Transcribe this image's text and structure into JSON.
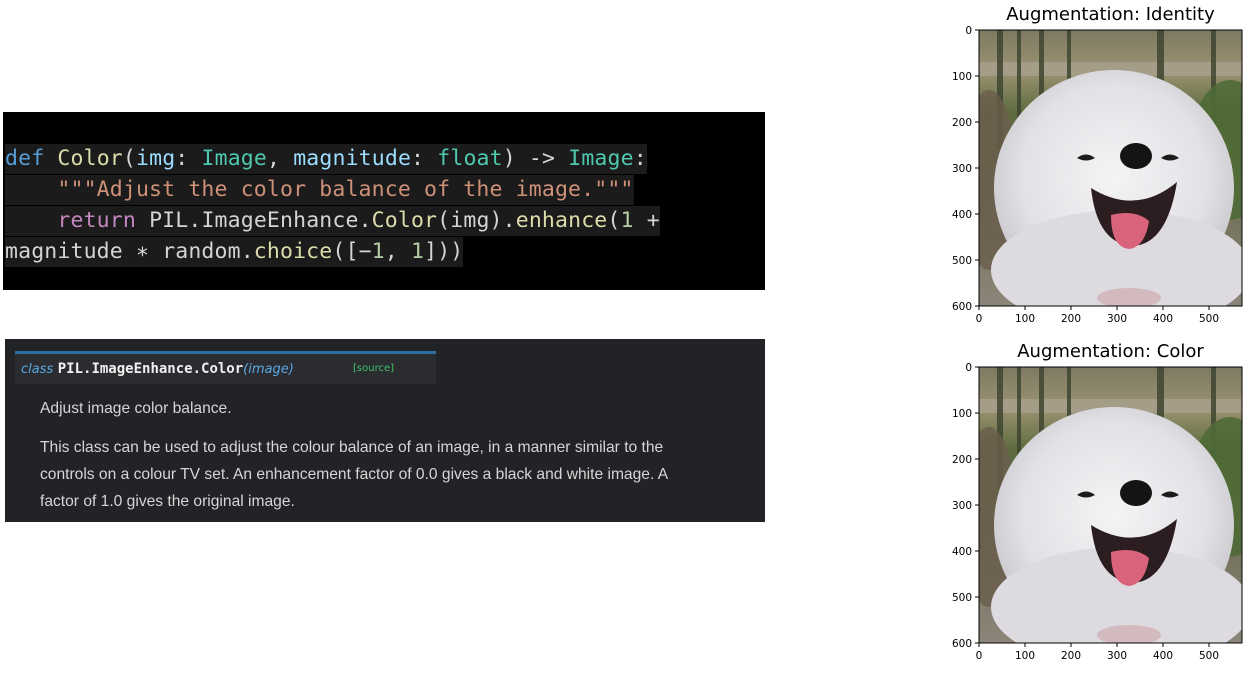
{
  "code": {
    "line1": [
      {
        "t": "def",
        "c": "kw"
      },
      {
        "t": " ",
        "c": ""
      },
      {
        "t": "Color",
        "c": "fn"
      },
      {
        "t": "(",
        "c": ""
      },
      {
        "t": "img",
        "c": "prm"
      },
      {
        "t": ": ",
        "c": ""
      },
      {
        "t": "Image",
        "c": "ty"
      },
      {
        "t": ", ",
        "c": ""
      },
      {
        "t": "magnitude",
        "c": "prm"
      },
      {
        "t": ": ",
        "c": ""
      },
      {
        "t": "float",
        "c": "ty"
      },
      {
        "t": ") -> ",
        "c": ""
      },
      {
        "t": "Image",
        "c": "ty"
      },
      {
        "t": ":",
        "c": ""
      }
    ],
    "line2": [
      {
        "t": "    ",
        "c": ""
      },
      {
        "t": "\"\"\"Adjust the color balance of the image.\"\"\"",
        "c": "str"
      }
    ],
    "line3": [
      {
        "t": "    ",
        "c": ""
      },
      {
        "t": "return",
        "c": "kw2"
      },
      {
        "t": " PIL.ImageEnhance.",
        "c": ""
      },
      {
        "t": "Color",
        "c": "fn"
      },
      {
        "t": "(img).",
        "c": ""
      },
      {
        "t": "enhance",
        "c": "fn"
      },
      {
        "t": "(",
        "c": ""
      },
      {
        "t": "1",
        "c": "num"
      },
      {
        "t": " +",
        "c": ""
      }
    ],
    "line4": [
      {
        "t": "magnitude ∗ random.",
        "c": ""
      },
      {
        "t": "choice",
        "c": "fn"
      },
      {
        "t": "([−",
        "c": ""
      },
      {
        "t": "1",
        "c": "num"
      },
      {
        "t": ", ",
        "c": ""
      },
      {
        "t": "1",
        "c": "num"
      },
      {
        "t": "]))",
        "c": ""
      }
    ]
  },
  "doc": {
    "signature": {
      "keyword": "class",
      "name": "PIL.ImageEnhance.Color",
      "open_paren": "(",
      "arg": "image",
      "close_paren": ")",
      "source_link": "[source]"
    },
    "summary": "Adjust image color balance.",
    "description_lines": [
      "This class can be used to adjust the colour balance of an image, in a manner similar to the",
      "controls on a colour TV set. An enhancement factor of 0.0 gives a black and white image. A",
      "factor of 1.0 gives the original image."
    ]
  },
  "plots": [
    {
      "title": "Augmentation: Identity",
      "x_ticks": [
        "0",
        "100",
        "200",
        "300",
        "400",
        "500"
      ],
      "y_ticks": [
        "0",
        "100",
        "200",
        "300",
        "400",
        "500",
        "600"
      ],
      "image_alt": "white fluffy dog photo"
    },
    {
      "title": "Augmentation: Color",
      "x_ticks": [
        "0",
        "100",
        "200",
        "300",
        "400",
        "500"
      ],
      "y_ticks": [
        "0",
        "100",
        "200",
        "300",
        "400",
        "500",
        "600"
      ],
      "image_alt": "white fluffy dog photo"
    }
  ]
}
